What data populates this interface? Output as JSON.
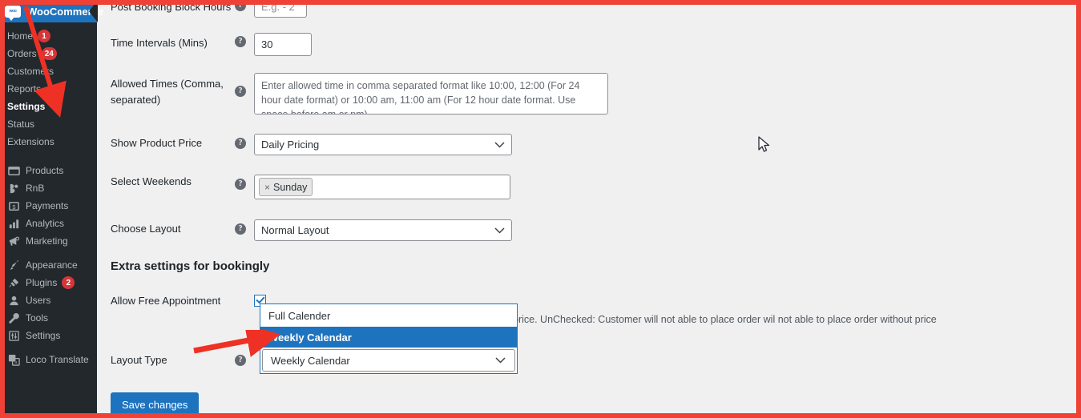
{
  "sidebar": {
    "brand": {
      "label": "WooCommerce",
      "logo_text": "woo",
      "bg_color": "#1e73be"
    },
    "submenu": [
      {
        "label": "Home",
        "badge": "1"
      },
      {
        "label": "Orders",
        "badge": "24"
      },
      {
        "label": "Customers",
        "badge": ""
      },
      {
        "label": "Reports",
        "badge": ""
      },
      {
        "label": "Settings",
        "badge": ""
      },
      {
        "label": "Status",
        "badge": ""
      },
      {
        "label": "Extensions",
        "badge": ""
      }
    ],
    "items": [
      {
        "label": "Products",
        "icon": "products-icon",
        "badge": ""
      },
      {
        "label": "RnB",
        "icon": "rnb-icon",
        "badge": ""
      },
      {
        "label": "Payments",
        "icon": "payments-icon",
        "badge": ""
      },
      {
        "label": "Analytics",
        "icon": "analytics-icon",
        "badge": ""
      },
      {
        "label": "Marketing",
        "icon": "marketing-megaphone-icon",
        "badge": ""
      },
      {
        "label": "Appearance",
        "icon": "appearance-brush-icon",
        "badge": ""
      },
      {
        "label": "Plugins",
        "icon": "plugins-plug-icon",
        "badge": "2"
      },
      {
        "label": "Users",
        "icon": "users-icon",
        "badge": ""
      },
      {
        "label": "Tools",
        "icon": "tools-wrench-icon",
        "badge": ""
      },
      {
        "label": "Settings",
        "icon": "settings-sliders-icon",
        "badge": ""
      },
      {
        "label": "Loco Translate",
        "icon": "loco-translate-icon",
        "badge": ""
      }
    ],
    "badge_color": "#d63638"
  },
  "form": {
    "rows": [
      {
        "label": "Post Booking Block Hours",
        "type": "text",
        "value": "",
        "placeholder": "E.g. - 2"
      },
      {
        "label": "Time Intervals (Mins)",
        "type": "text",
        "value": "30",
        "placeholder": ""
      },
      {
        "label": "Allowed Times (Comma, separated)",
        "type": "textarea",
        "value": "",
        "placeholder": "Enter allowed time in comma separated format like 10:00, 12:00 (For 24 hour date format) or 10:00 am, 11:00 am (For 12 hour date format. Use space before am or pm)"
      },
      {
        "label": "Show Product Price",
        "type": "select",
        "value": "Daily Pricing"
      },
      {
        "label": "Select Weekends",
        "type": "tags",
        "tags": [
          {
            "remove": "×",
            "label": "Sunday"
          }
        ]
      },
      {
        "label": "Choose Layout",
        "type": "select",
        "value": "Normal Layout"
      }
    ],
    "section_heading": "Extra settings for bookingly",
    "allow_free_appointment": {
      "label": "Allow Free Appointment",
      "checked": true,
      "helper_text": "price. UnChecked: Customer will not able to place order wil not able to place order without price"
    },
    "layout_type": {
      "label": "Layout Type",
      "value": "Weekly Calendar",
      "options": [
        "Full Calender",
        "Weekly Calendar"
      ],
      "selected_index": 1,
      "highlight_color": "#1e73be"
    },
    "save_button": "Save changes",
    "help_glyph": "?"
  },
  "annotation": {
    "frame_color": "#ef4136",
    "arrow_color": "#ee3124"
  }
}
